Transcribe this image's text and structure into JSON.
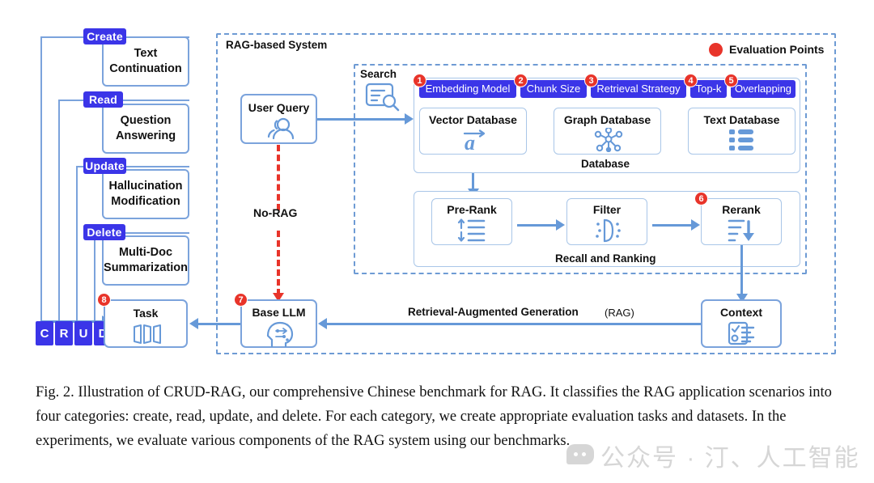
{
  "figure": {
    "title": "Illustration of CRUD-RAG",
    "caption": "Fig. 2.  Illustration of CRUD-RAG, our comprehensive Chinese benchmark for RAG. It classifies the RAG application scenarios into four categories: create, read, update, and delete. For each category, we create appropriate evaluation tasks and datasets. In the experiments, we evaluate various components of the RAG system using our benchmarks.",
    "watermark": "公众号 · 汀、人工智能"
  },
  "colors": {
    "badge_blue": "#3B35E8",
    "line_blue": "#7BA3DC",
    "arrow_blue": "#6699D8",
    "evaluation_red": "#E8342A",
    "box_border": "#A9C6E8"
  },
  "legend": {
    "label": "Evaluation Points"
  },
  "crud": {
    "categories": [
      {
        "badge": "Create",
        "task": "Text Continuation"
      },
      {
        "badge": "Read",
        "task": "Question Answering"
      },
      {
        "badge": "Update",
        "task": "Hallucination Modification"
      },
      {
        "badge": "Delete",
        "task": "Multi-Doc Summarization"
      }
    ],
    "letters": [
      "C",
      "R",
      "U",
      "D"
    ],
    "task_node": {
      "label": "Task",
      "eval_point": "8",
      "icon": "folded-pages-icon"
    }
  },
  "rag_system": {
    "label": "RAG-based System",
    "user_query": {
      "label": "User Query",
      "icon": "users-icon"
    },
    "no_rag": {
      "label": "No-RAG"
    },
    "search": {
      "label": "Search",
      "icon": "document-search-icon",
      "parameters": [
        {
          "num": "1",
          "label": "Embedding Model"
        },
        {
          "num": "2",
          "label": "Chunk Size"
        },
        {
          "num": "3",
          "label": "Retrieval Strategy"
        },
        {
          "num": "4",
          "label": "Top-k"
        },
        {
          "num": "5",
          "label": "Overlapping"
        }
      ],
      "database": {
        "label": "Database",
        "items": [
          {
            "label": "Vector Database",
            "icon": "vector-arrow-icon"
          },
          {
            "label": "Graph Database",
            "icon": "graph-nodes-icon"
          },
          {
            "label": "Text Database",
            "icon": "text-list-icon"
          }
        ]
      },
      "recall_and_ranking": {
        "label": "Recall and Ranking",
        "items": [
          {
            "label": "Pre-Rank",
            "icon": "sort-updown-icon",
            "eval_point": ""
          },
          {
            "label": "Filter",
            "icon": "funnel-dots-icon",
            "eval_point": ""
          },
          {
            "label": "Rerank",
            "icon": "sort-down-arrow-icon",
            "eval_point": "6"
          }
        ]
      }
    },
    "base_llm": {
      "label": "Base LLM",
      "icon": "brain-head-icon",
      "eval_point": "7"
    },
    "context": {
      "label": "Context",
      "icon": "checklist-icon"
    },
    "rag_flow_label": "Retrieval-Augmented Generation",
    "rag_flow_abbrev": "(RAG)"
  }
}
